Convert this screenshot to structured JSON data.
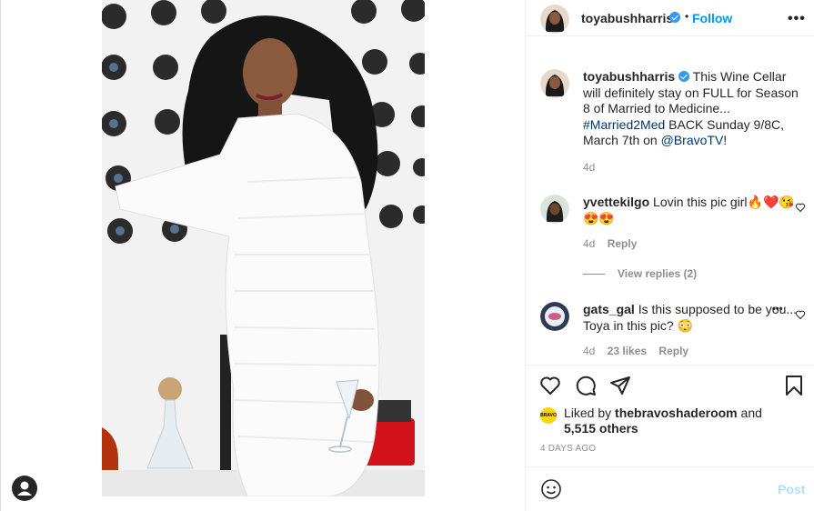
{
  "post": {
    "username": "toyabushharris",
    "follow_label": "Follow",
    "dot": "•",
    "more": "•••"
  },
  "caption": {
    "username": "toyabushharris",
    "text_pre": "This Wine Cellar will definitely stay on FULL for Season 8 of Married to Medicine... ",
    "hashtag": "#Married2Med",
    "text_mid": " BACK Sunday 9/8C, March 7th on ",
    "mention": "@BravoTV",
    "text_post": "!",
    "time": "4d"
  },
  "comments": [
    {
      "username": "yvettekilgo",
      "text": "Lovin this pic girl🔥❤️😘😍😍",
      "time": "4d",
      "reply": "Reply",
      "view_replies": "View replies (2)"
    },
    {
      "username": "gats_gal",
      "text": "Is this supposed to be you... Toya in this pic? 😳",
      "time": "4d",
      "likes": "23 likes",
      "reply": "Reply",
      "more": "•••"
    }
  ],
  "likes": {
    "avatar_text": "BRAVO SHADE ROOM",
    "liked_by": "Liked by",
    "liker": "thebravoshaderoom",
    "and": "and",
    "others": "5,515 others"
  },
  "timestamp": "4 DAYS AGO",
  "add_comment": {
    "post_label": "Post"
  },
  "colors": {
    "accent": "#0095f6",
    "verified": "#3897f0",
    "post_disabled": "#b2dffc"
  }
}
